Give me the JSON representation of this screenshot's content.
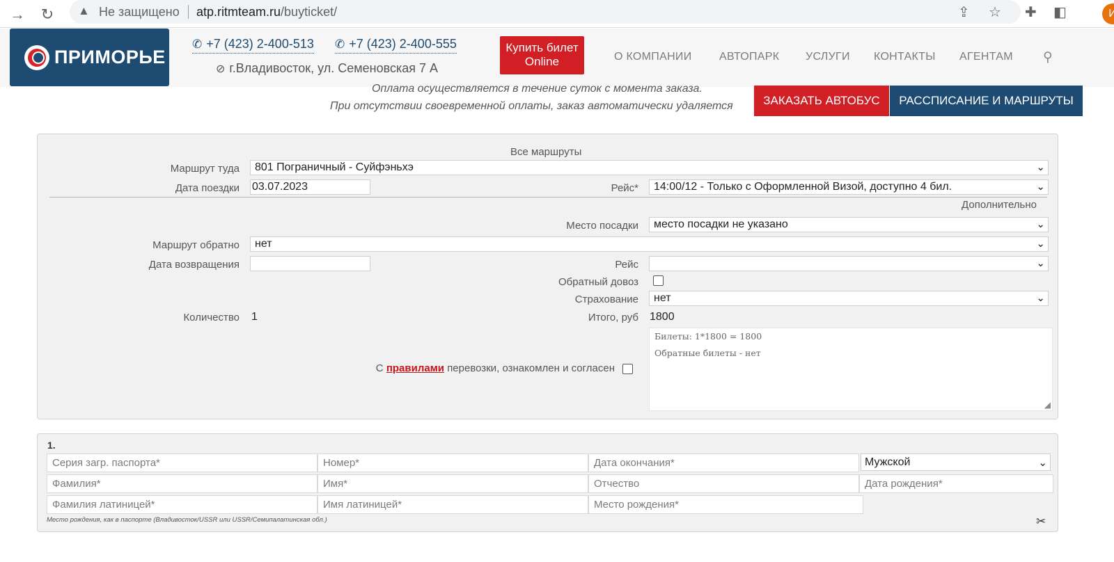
{
  "browser": {
    "insecure_label": "Не защищено",
    "url_host": "atp.ritmteam.ru",
    "url_path": "/buyticket/",
    "avatar_letter": "И"
  },
  "header": {
    "logo_text": "ПРИМОРЬЕ",
    "phone_1": "+7 (423) 2-400-513",
    "phone_2": "+7 (423) 2-400-555",
    "address": "г.Владивосток, ул. Семеновская 7 А",
    "buy_button": {
      "line1": "Купить билет",
      "line2": "Online"
    },
    "menu": [
      "О КОМПАНИИ",
      "АВТОПАРК",
      "УСЛУГИ",
      "КОНТАКТЫ",
      "АГЕНТАМ"
    ]
  },
  "notice": {
    "line1": "Оплата осуществляется в течение суток с момента заказа.",
    "line2": "При отсутствии своевременной оплаты, заказ автоматически удаляется"
  },
  "actions": {
    "order_bus": "ЗАКАЗАТЬ АВТОБУС",
    "schedule": "РАССПИСАНИЕ И МАРШРУТЫ"
  },
  "form": {
    "all_routes": "Все маршруты",
    "route_there_label": "Маршрут туда",
    "route_there_value": "801 Пограничный - Суйфэньхэ",
    "trip_date_label": "Дата поездки",
    "trip_date_value": "03.07.2023",
    "trip_label": "Рейс*",
    "trip_value": "14:00/12 - Только с Оформленной Визой, доступно 4 бил.",
    "additional": "Дополнительно",
    "boarding_label": "Место посадки",
    "boarding_value": "место посадки не указано",
    "route_back_label": "Маршрут обратно",
    "route_back_value": "нет",
    "return_date_label": "Дата возвращения",
    "return_date_value": "",
    "return_trip_label": "Рейс",
    "return_trip_value": "",
    "return_transfer_label": "Обратный довоз",
    "insurance_label": "Страхование",
    "insurance_value": "нет",
    "quantity_label": "Количество",
    "quantity_value": "1",
    "total_label": "Итого, руб",
    "total_value": "1800",
    "summary_line1": "Билеты: 1*1800 = 1800",
    "summary_line2": "Обратные билеты - нет",
    "agree_prefix": "С",
    "agree_link": "правилами",
    "agree_suffix": "перевозки, ознакомлен и согласен"
  },
  "passenger": {
    "number": "1.",
    "passport_series": "Серия загр. паспорта*",
    "passport_number": "Номер*",
    "expiry_date": "Дата окончания*",
    "gender_value": "Мужской",
    "last_name": "Фамилия*",
    "first_name": "Имя*",
    "middle_name": "Отчество",
    "birth_date": "Дата рождения*",
    "last_name_latin": "Фамилия латиницей*",
    "first_name_latin": "Имя латиницей*",
    "birth_place": "Место рождения*",
    "birth_place_hint": "Место рождения, как в паспорте (Владивосток/USSR или USSR/Семипалатинская обл.)"
  }
}
